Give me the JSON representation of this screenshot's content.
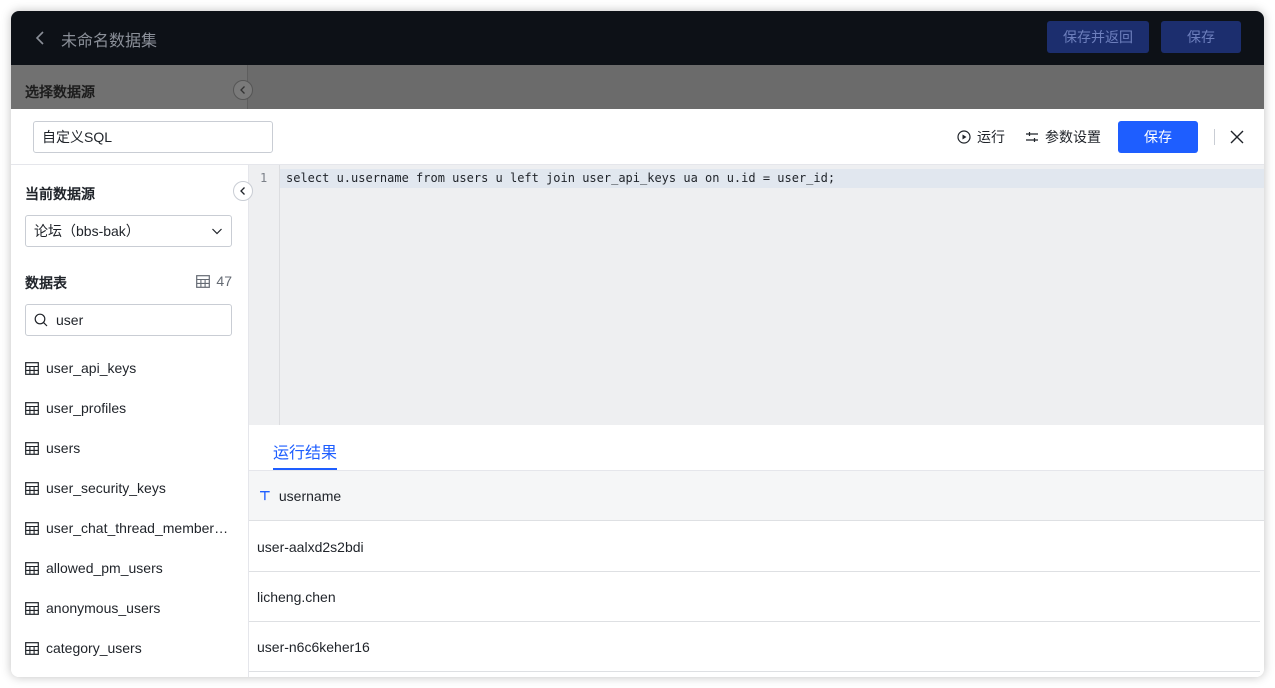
{
  "header": {
    "title": "未命名数据集",
    "save_and_return_label": "保存并返回",
    "save_label": "保存"
  },
  "underlying": {
    "section_label": "选择数据源"
  },
  "panel": {
    "name_value": "自定义SQL",
    "run_label": "运行",
    "params_label": "参数设置",
    "save_label": "保存"
  },
  "sidebar": {
    "current_source_label": "当前数据源",
    "datasource_value": "论坛（bbs-bak）",
    "tables_label": "数据表",
    "table_count": "47",
    "search_value": "user",
    "tables": [
      {
        "label": "user_api_keys"
      },
      {
        "label": "user_profiles"
      },
      {
        "label": "users"
      },
      {
        "label": "user_security_keys"
      },
      {
        "label": "user_chat_thread_memberships"
      },
      {
        "label": "allowed_pm_users"
      },
      {
        "label": "anonymous_users"
      },
      {
        "label": "category_users"
      }
    ]
  },
  "editor": {
    "line_number": "1",
    "code": "select u.username from users u left join user_api_keys ua on u.id = user_id;"
  },
  "results": {
    "tab_label": "运行结果",
    "column_header": "username",
    "rows": [
      {
        "username": "user-aalxd2s2bdi"
      },
      {
        "username": "licheng.chen"
      },
      {
        "username": "user-n6c6keher16"
      }
    ]
  },
  "colors": {
    "primary": "#1e5eff",
    "header_bg": "#0d1117"
  }
}
